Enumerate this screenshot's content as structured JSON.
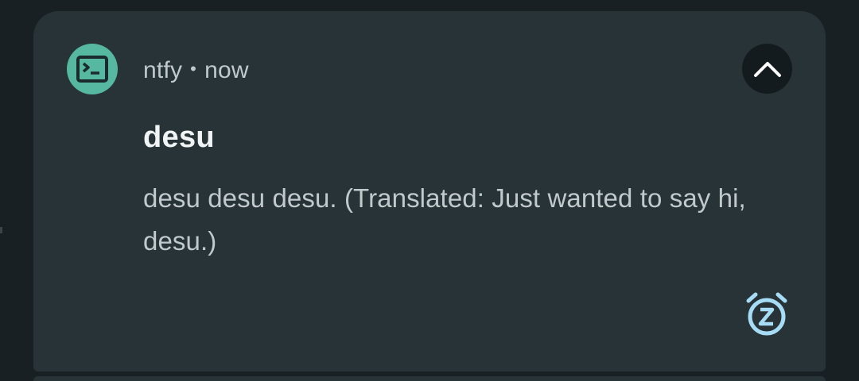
{
  "notification": {
    "app_name": "ntfy",
    "separator": "•",
    "time": "now",
    "title": "desu",
    "message": "desu desu desu. (Translated: Just wanted to say hi, desu.)"
  },
  "icons": {
    "app": "terminal-icon",
    "collapse": "chevron-up-icon",
    "snooze": "snooze-alarm-icon"
  },
  "colors": {
    "background": "#182023",
    "card": "#283337",
    "app_icon": "#56b8a0",
    "snooze_icon": "#a6dcf5",
    "title": "#f1f4f4",
    "body_text": "#c0c9cc"
  }
}
